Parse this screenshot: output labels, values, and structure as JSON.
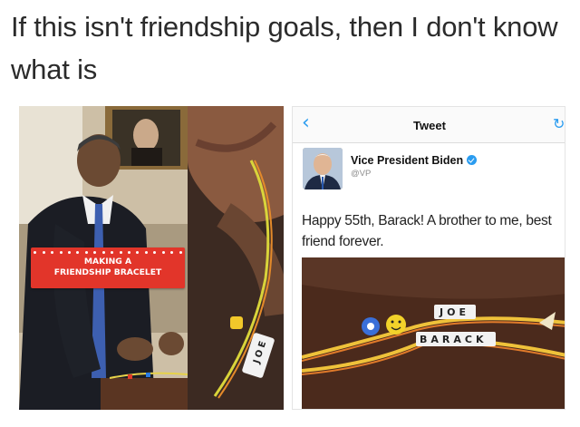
{
  "caption": "If this isn't friendship goals, then I don't know what is",
  "left_panel": {
    "banner_text": "MAKING A\nFRIENDSHIP BRACELET"
  },
  "middle_panel": {
    "bead_text": "JOE"
  },
  "tweet": {
    "nav_title": "Tweet",
    "back_icon": "chevron-left-icon",
    "refresh_icon": "refresh-icon",
    "user_name": "Vice President Biden",
    "handle": "@VP",
    "text": "Happy 55th, Barack! A brother to me, best friend forever.",
    "bracelet_beads_top": "JOE",
    "bracelet_beads_bottom": "BARACK",
    "colors": {
      "accent": "#2a9cf0",
      "banner": "#e2352a"
    }
  }
}
